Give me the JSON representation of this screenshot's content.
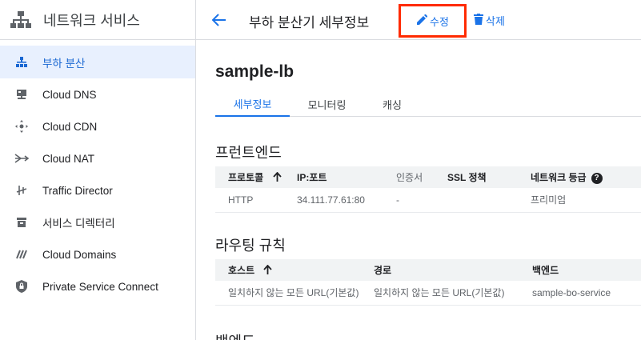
{
  "sidebar": {
    "title": "네트워크 서비스",
    "items": [
      {
        "label": "부하 분산",
        "icon": "load-balancer-icon",
        "active": true
      },
      {
        "label": "Cloud DNS",
        "icon": "dns-icon"
      },
      {
        "label": "Cloud CDN",
        "icon": "cdn-icon"
      },
      {
        "label": "Cloud NAT",
        "icon": "nat-icon"
      },
      {
        "label": "Traffic Director",
        "icon": "traffic-director-icon"
      },
      {
        "label": "서비스 디렉터리",
        "icon": "service-directory-icon"
      },
      {
        "label": "Cloud Domains",
        "icon": "domains-icon"
      },
      {
        "label": "Private Service Connect",
        "icon": "shield-icon"
      }
    ]
  },
  "header": {
    "title": "부하 분산기 세부정보",
    "edit_label": "수정",
    "delete_label": "삭제"
  },
  "main": {
    "lb_name": "sample-lb",
    "tabs": [
      "세부정보",
      "모니터링",
      "캐싱"
    ],
    "frontend": {
      "heading": "프런트엔드",
      "columns": [
        "프로토콜",
        "IP:포트",
        "인증서",
        "SSL 정책",
        "네트워크 등급"
      ],
      "rows": [
        [
          "HTTP",
          "34.111.77.61:80",
          "-",
          "",
          "프리미엄"
        ]
      ]
    },
    "routing": {
      "heading": "라우팅 규칙",
      "columns": [
        "호스트",
        "경로",
        "백엔드"
      ],
      "rows": [
        [
          "일치하지 않는 모든 URL(기본값)",
          "일치하지 않는 모든 URL(기본값)",
          "sample-bo-service"
        ]
      ]
    },
    "backend_heading": "백엔드"
  },
  "colors": {
    "accent": "#1a73e8",
    "highlight_box": "#ff2a00",
    "active_bg": "#e8f0fe"
  }
}
